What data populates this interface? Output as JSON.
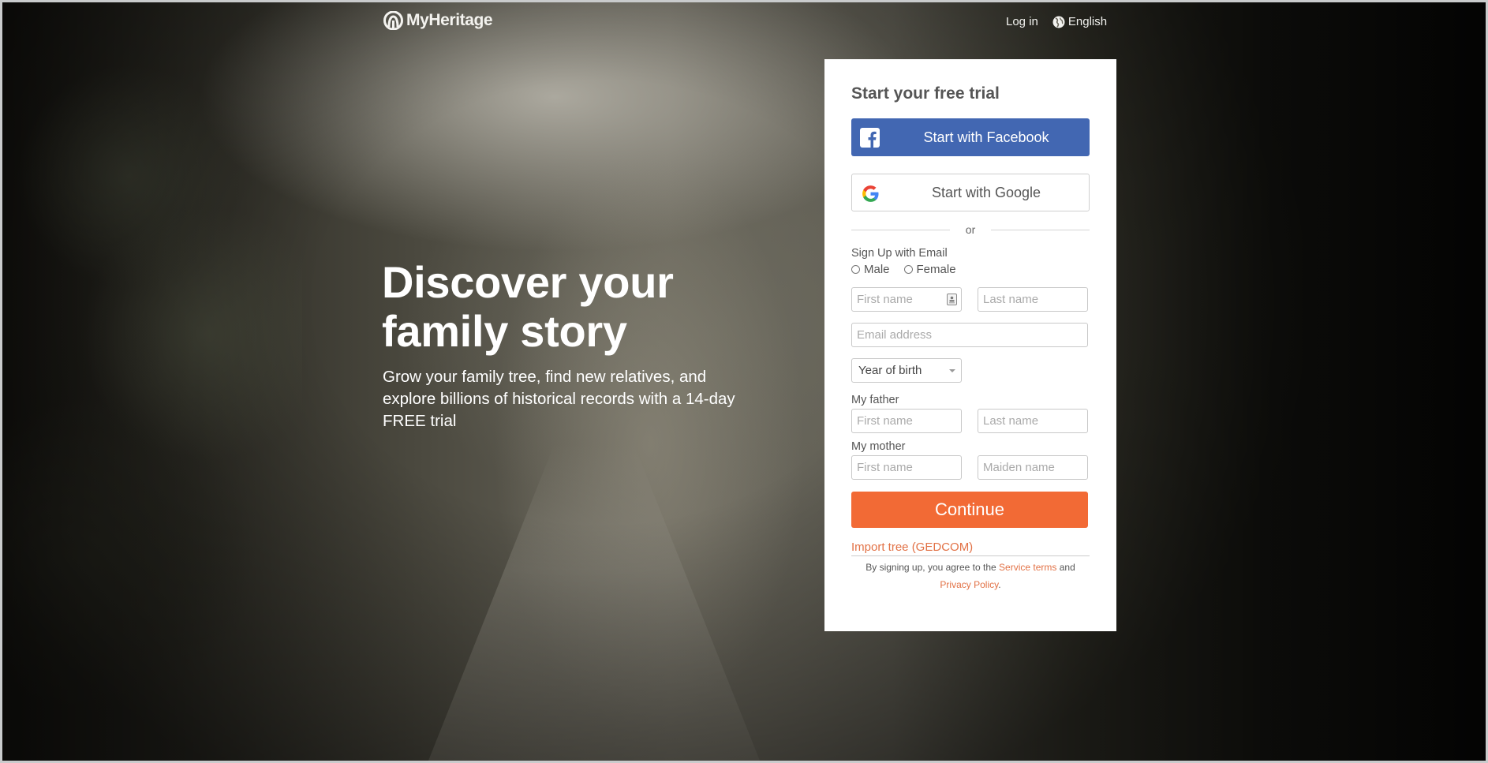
{
  "header": {
    "brand": "MyHeritage",
    "logo_icon": "myheritage-logo-icon",
    "login_label": "Log in",
    "language_icon": "globe-icon",
    "language_label": "English"
  },
  "hero": {
    "headline_line1": "Discover your",
    "headline_line2": "family story",
    "subline": "Grow your family tree, find new relatives, and explore billions of historical records with a 14-day FREE trial"
  },
  "signup": {
    "title": "Start your free trial",
    "facebook_label": "Start with Facebook",
    "google_label": "Start with Google",
    "divider_text": "or",
    "email_section_label": "Sign Up with Email",
    "gender_options": [
      "Male",
      "Female"
    ],
    "first_name_placeholder": "First name",
    "last_name_placeholder": "Last name",
    "email_placeholder": "Email address",
    "year_of_birth_label": "Year of birth",
    "father_label": "My father",
    "father_first_placeholder": "First name",
    "father_last_placeholder": "Last name",
    "mother_label": "My mother",
    "mother_first_placeholder": "First name",
    "mother_maiden_placeholder": "Maiden name",
    "continue_label": "Continue",
    "import_label": "Import tree (GEDCOM)",
    "legal_prefix": "By signing up, you agree to the",
    "service_terms_label": "Service terms",
    "legal_and": "and",
    "privacy_label": "Privacy Policy",
    "legal_suffix": "."
  },
  "colors": {
    "facebook_blue": "#4267b2",
    "continue_orange": "#f26a35",
    "link_orange": "#e27145"
  }
}
